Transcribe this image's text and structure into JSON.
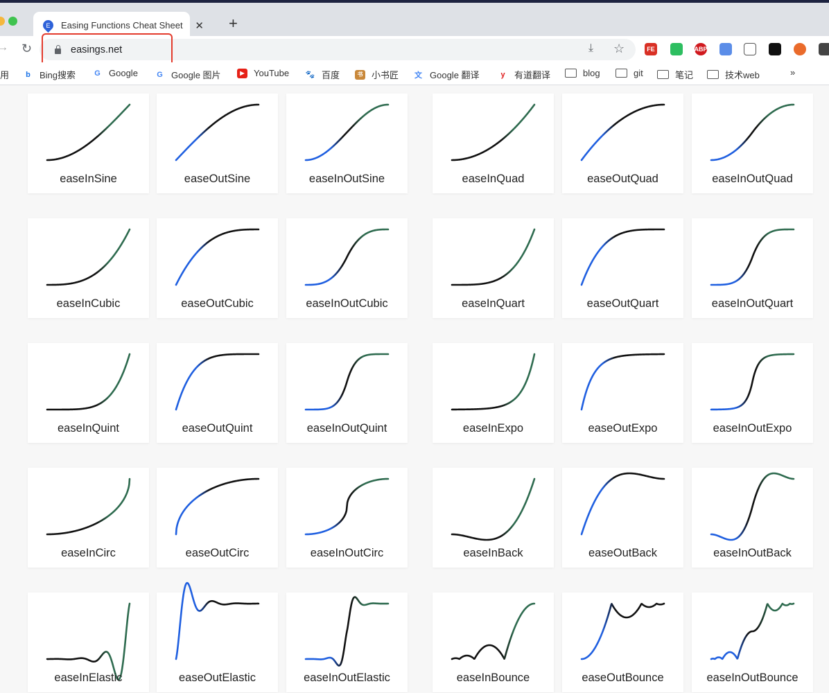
{
  "browser": {
    "tab_title": "Easing Functions Cheat Sheet",
    "favicon_letter": "E",
    "url": "easings.net",
    "bookmarks": [
      {
        "label": "用",
        "icon": "apps-icon"
      },
      {
        "label": "Bing搜索",
        "icon": "bing-icon"
      },
      {
        "label": "Google",
        "icon": "google-icon"
      },
      {
        "label": "Google 图片",
        "icon": "google-icon"
      },
      {
        "label": "YouTube",
        "icon": "youtube-icon"
      },
      {
        "label": "百度",
        "icon": "baidu-icon"
      },
      {
        "label": "小书匠",
        "icon": "xiaoshujiang-icon"
      },
      {
        "label": "Google 翻译",
        "icon": "google-translate-icon"
      },
      {
        "label": "有道翻译",
        "icon": "youdao-icon"
      },
      {
        "label": "blog",
        "icon": "folder-icon"
      },
      {
        "label": "git",
        "icon": "folder-icon"
      },
      {
        "label": "笔记",
        "icon": "folder-icon"
      },
      {
        "label": "技术web",
        "icon": "folder-icon"
      }
    ],
    "more": "»",
    "extensions": [
      {
        "name": "fe-icon",
        "text": "FE"
      },
      {
        "name": "evernote-icon",
        "text": ""
      },
      {
        "name": "adblock-icon",
        "text": "ABP"
      },
      {
        "name": "search-ext-icon",
        "text": ""
      },
      {
        "name": "tv-icon",
        "text": ""
      },
      {
        "name": "tampermonkey-icon",
        "text": ""
      },
      {
        "name": "orange-ext-icon",
        "text": ""
      },
      {
        "name": "puzzle-icon",
        "text": ""
      }
    ]
  },
  "colors": {
    "in": "#2e6b4f",
    "out": "#1f5fe0",
    "mid": "#111111"
  },
  "easings": [
    "easeInSine",
    "easeOutSine",
    "easeInOutSine",
    "easeInQuad",
    "easeOutQuad",
    "easeInOutQuad",
    "easeInCubic",
    "easeOutCubic",
    "easeInOutCubic",
    "easeInQuart",
    "easeOutQuart",
    "easeInOutQuart",
    "easeInQuint",
    "easeOutQuint",
    "easeInOutQuint",
    "easeInExpo",
    "easeOutExpo",
    "easeInOutExpo",
    "easeInCirc",
    "easeOutCirc",
    "easeInOutCirc",
    "easeInBack",
    "easeOutBack",
    "easeInOutBack",
    "easeInElastic",
    "easeOutElastic",
    "easeInOutElastic",
    "easeInBounce",
    "easeOutBounce",
    "easeInOutBounce"
  ]
}
